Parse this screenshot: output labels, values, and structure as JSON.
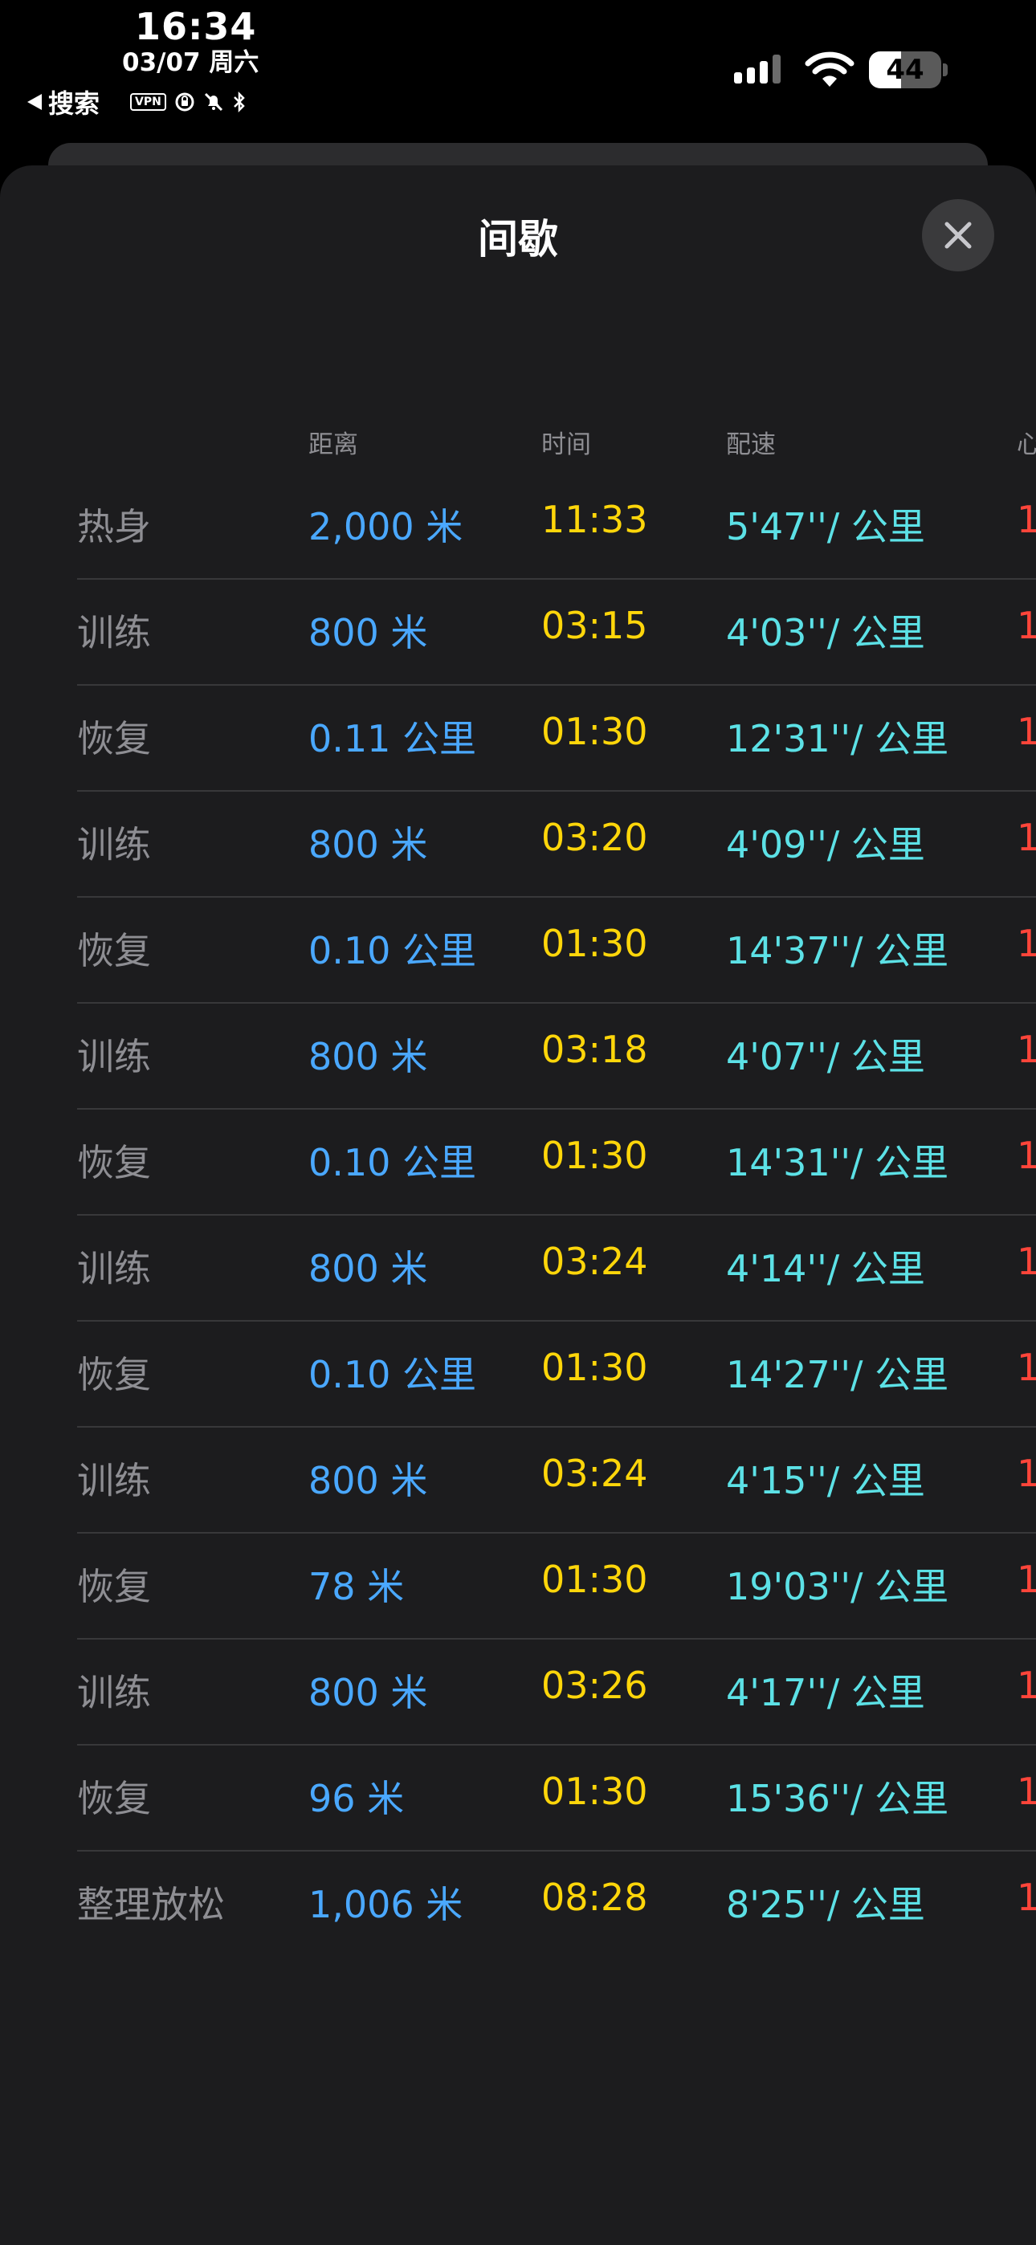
{
  "status_bar": {
    "time": "16:34",
    "date": "03/07 周六",
    "back_label": "搜索",
    "vpn_label": "VPN",
    "battery_percent": 44,
    "battery_label": "44"
  },
  "sheet": {
    "title": "间歇"
  },
  "table": {
    "headers": {
      "distance": "距离",
      "time": "时间",
      "pace": "配速",
      "heart_rate": "心"
    },
    "rows": [
      {
        "label": "热身",
        "distance": "2,000 米",
        "time": "11:33",
        "pace": "5'47''/ 公里",
        "hr": "1"
      },
      {
        "label": "训练",
        "distance": "800 米",
        "time": "03:15",
        "pace": "4'03''/ 公里",
        "hr": "1"
      },
      {
        "label": "恢复",
        "distance": "0.11 公里",
        "time": "01:30",
        "pace": "12'31''/ 公里",
        "hr": "1"
      },
      {
        "label": "训练",
        "distance": "800 米",
        "time": "03:20",
        "pace": "4'09''/ 公里",
        "hr": "1"
      },
      {
        "label": "恢复",
        "distance": "0.10 公里",
        "time": "01:30",
        "pace": "14'37''/ 公里",
        "hr": "1"
      },
      {
        "label": "训练",
        "distance": "800 米",
        "time": "03:18",
        "pace": "4'07''/ 公里",
        "hr": "1"
      },
      {
        "label": "恢复",
        "distance": "0.10 公里",
        "time": "01:30",
        "pace": "14'31''/ 公里",
        "hr": "1"
      },
      {
        "label": "训练",
        "distance": "800 米",
        "time": "03:24",
        "pace": "4'14''/ 公里",
        "hr": "1"
      },
      {
        "label": "恢复",
        "distance": "0.10 公里",
        "time": "01:30",
        "pace": "14'27''/ 公里",
        "hr": "1"
      },
      {
        "label": "训练",
        "distance": "800 米",
        "time": "03:24",
        "pace": "4'15''/ 公里",
        "hr": "1"
      },
      {
        "label": "恢复",
        "distance": "78 米",
        "time": "01:30",
        "pace": "19'03''/ 公里",
        "hr": "1"
      },
      {
        "label": "训练",
        "distance": "800 米",
        "time": "03:26",
        "pace": "4'17''/ 公里",
        "hr": "1"
      },
      {
        "label": "恢复",
        "distance": "96 米",
        "time": "01:30",
        "pace": "15'36''/ 公里",
        "hr": "1"
      },
      {
        "label": "整理放松",
        "distance": "1,006 米",
        "time": "08:28",
        "pace": "8'25''/ 公里",
        "hr": "1"
      }
    ]
  },
  "colors": {
    "distance": "#4aa8ff",
    "time": "#ffd60a",
    "pace": "#5ce1e6",
    "heart_rate": "#ff453a",
    "sheet_bg": "#1c1c1e"
  },
  "icons": {
    "close": "close-icon",
    "back": "back-triangle-icon",
    "wifi": "wifi-icon",
    "signal": "cellular-signal-icon",
    "battery": "battery-icon"
  }
}
